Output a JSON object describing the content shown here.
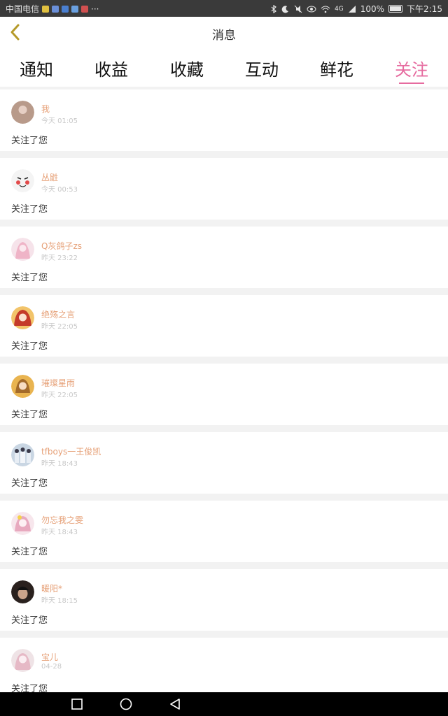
{
  "status": {
    "carrier": "中国电信",
    "battery": "100%",
    "time": "下午2:15",
    "network": "4G",
    "more": "···"
  },
  "header": {
    "title": "消息",
    "back_icon": "chevron-left-icon"
  },
  "tabs": [
    {
      "label": "通知",
      "active": false
    },
    {
      "label": "收益",
      "active": false
    },
    {
      "label": "收藏",
      "active": false
    },
    {
      "label": "互动",
      "active": false
    },
    {
      "label": "鲜花",
      "active": false
    },
    {
      "label": "关注",
      "active": true
    }
  ],
  "colors": {
    "accent": "#e66b9f",
    "name": "#e6a077",
    "time": "#c8c8c8"
  },
  "items": [
    {
      "name": "我",
      "time": "今天 01:05",
      "message": "关注了您",
      "avatar_color": "#b89a8a"
    },
    {
      "name": "丛鼪",
      "time": "今天 00:53",
      "message": "关注了您",
      "avatar_color": "#f4f4f4"
    },
    {
      "name": "Q灰鸽子zs",
      "time": "昨天 23:22",
      "message": "关注了您",
      "avatar_color": "#efc2d3"
    },
    {
      "name": "绝殇之言",
      "time": "昨天 22:05",
      "message": "关注了您",
      "avatar_color": "#d85a3a"
    },
    {
      "name": "璀璨星雨",
      "time": "昨天 22:05",
      "message": "关注了您",
      "avatar_color": "#d9a24a"
    },
    {
      "name": "tfboys一王俊凯",
      "time": "昨天 18:43",
      "message": "关注了您",
      "avatar_color": "#8aa0b8"
    },
    {
      "name": "勿忘我之雯",
      "time": "昨天 18:43",
      "message": "关注了您",
      "avatar_color": "#e7b8c8"
    },
    {
      "name": "暖阳*",
      "time": "昨天 18:15",
      "message": "关注了您",
      "avatar_color": "#3a2e2a"
    },
    {
      "name": "宝儿",
      "time": "04-28",
      "message": "关注了您",
      "avatar_color": "#e8c7cf"
    }
  ]
}
